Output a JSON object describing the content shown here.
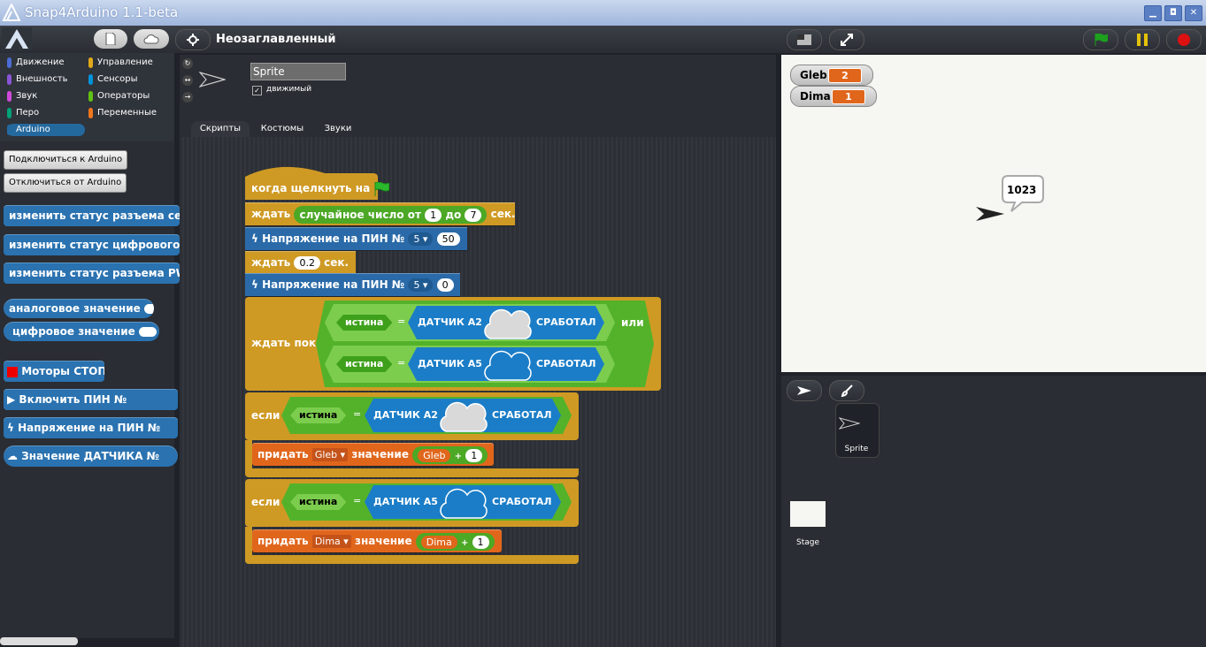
{
  "window": {
    "title": "Snap4Arduino 1.1-beta",
    "min": "▁",
    "max": "◘",
    "close": "✕"
  },
  "topbar": {
    "project_title": "Неозаглавленный"
  },
  "categories": [
    {
      "label": "Движение",
      "color": "#4a6cd4"
    },
    {
      "label": "Управление",
      "color": "#e1a91a"
    },
    {
      "label": "Внешность",
      "color": "#8a55d7"
    },
    {
      "label": "Сенсоры",
      "color": "#0093d9"
    },
    {
      "label": "Звук",
      "color": "#cf4ad9"
    },
    {
      "label": "Операторы",
      "color": "#62c213"
    },
    {
      "label": "Перо",
      "color": "#00a178"
    },
    {
      "label": "Переменные",
      "color": "#f3761d"
    },
    {
      "label": "Arduino",
      "color": "#24699e"
    }
  ],
  "palette": {
    "connect": "Подключиться к Arduino",
    "disconnect": "Отключиться от Arduino",
    "blocks": [
      "изменить статус разъема серво",
      "изменить статус цифрового разъема",
      "изменить статус разъема PWM",
      "аналоговое значение",
      "цифровое значение",
      "Моторы СТОП",
      "Включить ПИН №",
      "Напряжение на ПИН №",
      "Значение ДАТЧИКА №"
    ]
  },
  "sprite": {
    "name": "Sprite",
    "draggable_label": "движимый"
  },
  "tabs": [
    "Скрипты",
    "Костюмы",
    "Звуки"
  ],
  "script": {
    "hat": "когда щелкнуть на",
    "wait": "ждать",
    "random": "случайное число от",
    "rand_from": "1",
    "rand_to_label": "до",
    "rand_to": "7",
    "sec": "сек.",
    "voltage": "Напряжение на ПИН №",
    "pin": "5",
    "v1": "50",
    "wait2": "0.2",
    "v2": "0",
    "wait_until": "ждать пока",
    "true": "истина",
    "eq": "=",
    "sensor_a2": "ДАТЧИК A2",
    "sensor_a5": "ДАТЧИК A5",
    "triggered": "СРАБОТАЛ",
    "or": "или",
    "if": "если",
    "set": "придать",
    "value": "значение",
    "var_gleb": "Gleb",
    "var_dima": "Dima",
    "plus": "+",
    "one": "1"
  },
  "stage": {
    "watchers": [
      {
        "name": "Gleb",
        "value": "2"
      },
      {
        "name": "Dima",
        "value": "1"
      }
    ],
    "speech": "1023"
  },
  "corral": {
    "sprite_label": "Sprite",
    "stage_label": "Stage"
  }
}
